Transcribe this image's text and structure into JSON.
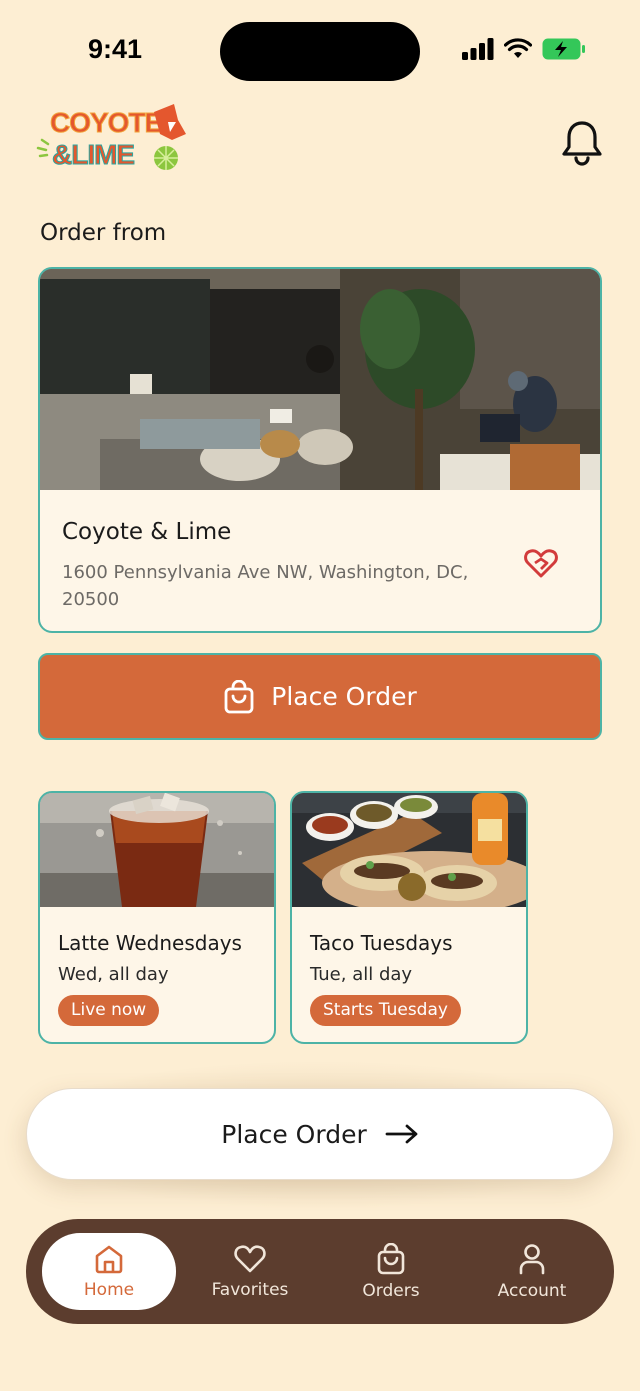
{
  "status_bar": {
    "time": "9:41"
  },
  "header": {
    "logo_line1": "COYOTE",
    "logo_line2": "&LIME"
  },
  "order_from": {
    "title": "Order from",
    "location": {
      "name": "Coyote & Lime",
      "address": "1600 Pennsylvania Ave NW, Washington, DC, 20500"
    }
  },
  "primary_button": {
    "label": "Place Order"
  },
  "promos": [
    {
      "title": "Latte Wednesdays",
      "subtitle": "Wed, all day",
      "badge": "Live now"
    },
    {
      "title": "Taco Tuesdays",
      "subtitle": "Tue, all day",
      "badge": "Starts Tuesday"
    }
  ],
  "floating_cta": {
    "label": "Place Order"
  },
  "bottom_nav": {
    "items": [
      {
        "label": "Home",
        "icon": "home-icon",
        "active": true
      },
      {
        "label": "Favorites",
        "icon": "heart-icon",
        "active": false
      },
      {
        "label": "Orders",
        "icon": "bag-icon",
        "active": false
      },
      {
        "label": "Account",
        "icon": "person-icon",
        "active": false
      }
    ]
  },
  "colors": {
    "background": "#fdeed3",
    "accent": "#d4693a",
    "border": "#4db3a6",
    "nav": "#5c3d2e",
    "card": "#fef6e8"
  }
}
